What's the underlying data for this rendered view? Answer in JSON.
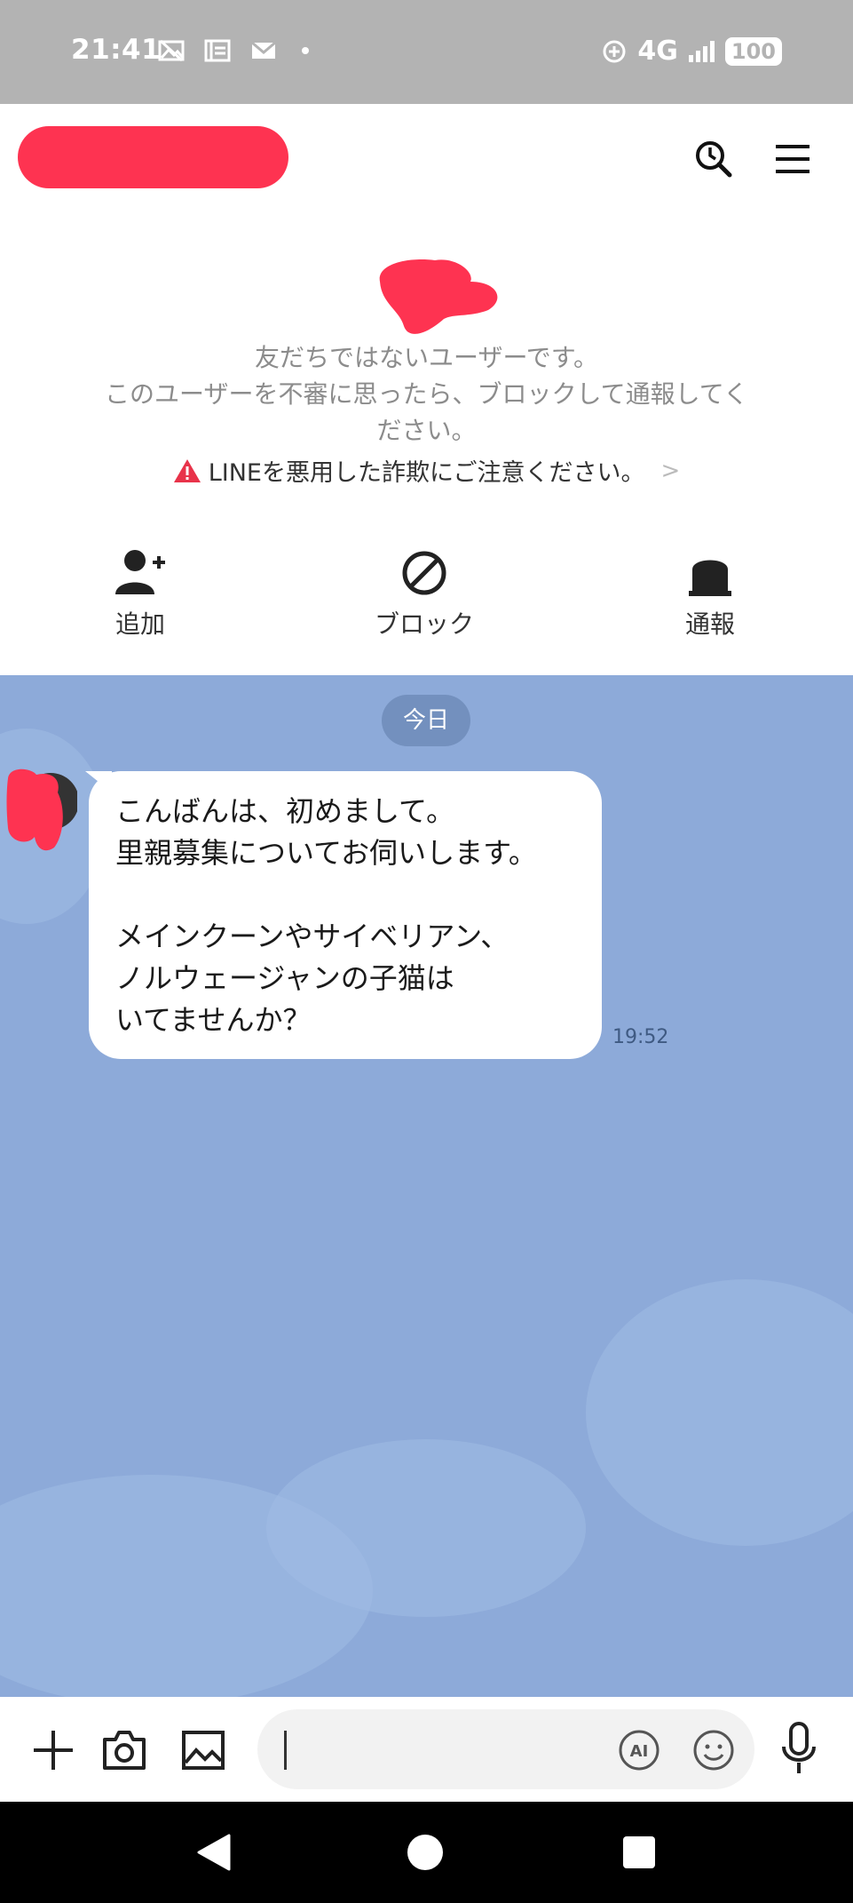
{
  "status_bar": {
    "time": "21:41",
    "network": "4G",
    "battery": "100"
  },
  "header": {
    "chat_name": "",
    "search_icon": "search-icon",
    "menu_icon": "menu-icon"
  },
  "notice": {
    "line1": "友だちではないユーザーです。",
    "line2": "このユーザーを不審に思ったら、ブロックして通報してく",
    "line3": "ださい。",
    "warning": "LINEを悪用した詐欺にご注意ください。",
    "warning_color": "#e8334a"
  },
  "actions": {
    "add": "追加",
    "block": "ブロック",
    "report": "通報"
  },
  "chat": {
    "date_label": "今日",
    "background_color": "#8daad9",
    "messages": [
      {
        "text": "こんばんは、初めまして。\n里親募集についてお伺いします。\n\nメインクーンやサイベリアン、\nノルウェージャンの子猫は\nいてませんか？",
        "time": "19:52"
      }
    ]
  },
  "input_bar": {
    "placeholder": "",
    "ai_label": "AI"
  }
}
